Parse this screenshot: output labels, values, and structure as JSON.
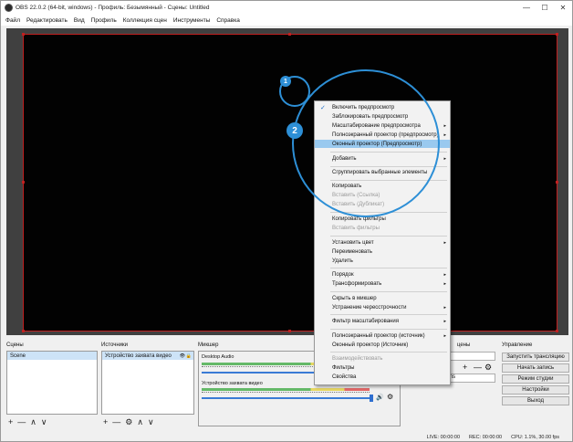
{
  "window": {
    "title": "OBS 22.0.2 (64-bit, windows) - Профиль: Безымянный - Сцены: Untitled",
    "minimize_glyph": "—",
    "maximize_glyph": "☐",
    "close_glyph": "✕"
  },
  "menubar": [
    "Файл",
    "Редактировать",
    "Вид",
    "Профиль",
    "Коллекция сцен",
    "Инструменты",
    "Справка"
  ],
  "docks": {
    "scenes_title": "Сцены",
    "sources_title": "Источники",
    "mixer_title": "Микшер",
    "transitions_title": "цены",
    "controls_title": "Управление"
  },
  "scenes": [
    "Scene"
  ],
  "sources": [
    "Устройство захвата видео"
  ],
  "mixer": {
    "tracks": [
      {
        "name": "Desktop Audio",
        "level": 0.0
      },
      {
        "name": "Устройство захвата видео",
        "level": 0.0
      }
    ]
  },
  "transition": {
    "duration_label": "ms"
  },
  "controls": [
    "Запустить трансляцию",
    "Начать запись",
    "Режим студии",
    "Настройки",
    "Выход"
  ],
  "status": {
    "live": "LIVE: 00:00:00",
    "rec": "REC: 00:00:00",
    "cpu": "CPU: 1.1%, 30.00 fps"
  },
  "context_menu": {
    "items": [
      {
        "label": "Включить предпросмотр",
        "checked": true,
        "submenu": false,
        "disabled": false
      },
      {
        "label": "Заблокировать предпросмотр",
        "submenu": false,
        "disabled": false
      },
      {
        "label": "Масштабирование предпросмотра",
        "submenu": true,
        "disabled": false
      },
      {
        "label": "Полноэкранный проектор (предпросмотр)",
        "submenu": true,
        "disabled": false
      },
      {
        "label": "Оконный проектор (Предпросмотр)",
        "submenu": false,
        "disabled": false,
        "highlighted": true
      },
      {
        "label": "Добавить",
        "submenu": true,
        "disabled": false
      },
      {
        "label": "Сгруппировать выбранные элементы",
        "submenu": false,
        "disabled": false
      },
      {
        "label": "Копировать",
        "submenu": false,
        "disabled": false
      },
      {
        "label": "Вставить (Ссылка)",
        "submenu": false,
        "disabled": true
      },
      {
        "label": "Вставить (Дубликат)",
        "submenu": false,
        "disabled": true
      },
      {
        "label": "Копировать фильтры",
        "submenu": false,
        "disabled": false
      },
      {
        "label": "Вставить фильтры",
        "submenu": false,
        "disabled": true
      },
      {
        "label": "Установить цвет",
        "submenu": true,
        "disabled": false
      },
      {
        "label": "Переименовать",
        "submenu": false,
        "disabled": false
      },
      {
        "label": "Удалить",
        "submenu": false,
        "disabled": false
      },
      {
        "label": "Порядок",
        "submenu": true,
        "disabled": false
      },
      {
        "label": "Трансформировать",
        "submenu": true,
        "disabled": false
      },
      {
        "label": "Скрыть в микшер",
        "submenu": false,
        "disabled": false
      },
      {
        "label": "Устранение чересстрочности",
        "submenu": true,
        "disabled": false
      },
      {
        "label": "Фильтр масштабирования",
        "submenu": true,
        "disabled": false
      },
      {
        "label": "Полноэкранный проектор (источник)",
        "submenu": true,
        "disabled": false
      },
      {
        "label": "Оконный проектор (Источник)",
        "submenu": false,
        "disabled": false
      },
      {
        "label": "Взаимодействовать",
        "submenu": false,
        "disabled": true
      },
      {
        "label": "Фильтры",
        "submenu": false,
        "disabled": false
      },
      {
        "label": "Свойства",
        "submenu": false,
        "disabled": false
      }
    ]
  },
  "callouts": [
    "1",
    "2"
  ],
  "icons": {
    "add": "+",
    "remove": "—",
    "up": "∧",
    "down": "∨",
    "gear": "⚙",
    "eye": "👁",
    "lock": "🔒",
    "speaker": "🔊",
    "arrow": "▸",
    "check": "✓"
  },
  "colors": {
    "accent": "#2d8fd6",
    "preview_border": "#c02020",
    "highlight": "#99c9ef"
  }
}
